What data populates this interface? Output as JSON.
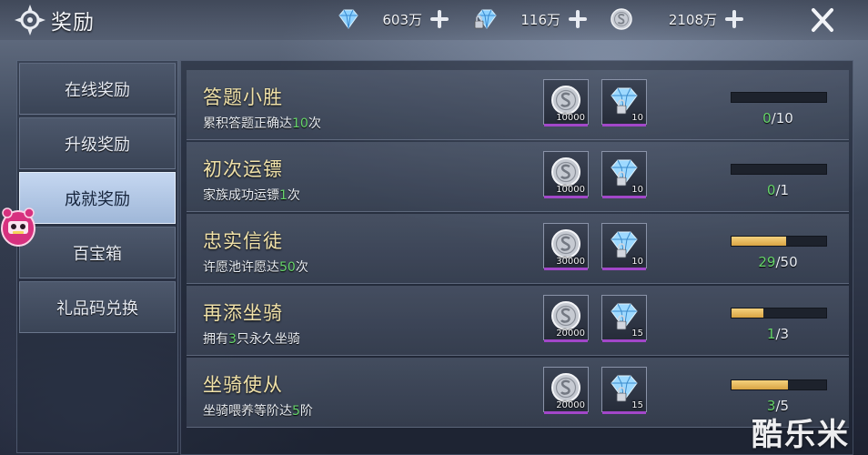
{
  "header": {
    "title": "奖励",
    "currencies": [
      {
        "icon": "diamond-icon",
        "value": "603万"
      },
      {
        "icon": "bound-diamond-icon",
        "value": "116万"
      },
      {
        "icon": "silver-coin-icon",
        "value": "2108万"
      }
    ]
  },
  "sidebar": {
    "items": [
      {
        "label": "在线奖励",
        "active": false
      },
      {
        "label": "升级奖励",
        "active": false
      },
      {
        "label": "成就奖励",
        "active": true
      },
      {
        "label": "百宝箱",
        "active": false
      },
      {
        "label": "礼品码兑换",
        "active": false
      }
    ]
  },
  "achievements": [
    {
      "title": "答题小胜",
      "desc_pre": "累积答题正确达",
      "desc_num": "10",
      "desc_post": "次",
      "rewards": [
        {
          "icon": "silver-coin-icon",
          "count": "10000"
        },
        {
          "icon": "locked-diamond-icon",
          "count": "10"
        }
      ],
      "progress_current": "0",
      "progress_total": "/10",
      "progress_fraction": 0
    },
    {
      "title": "初次运镖",
      "desc_pre": "家族成功运镖",
      "desc_num": "1",
      "desc_post": "次",
      "rewards": [
        {
          "icon": "silver-coin-icon",
          "count": "10000"
        },
        {
          "icon": "locked-diamond-icon",
          "count": "10"
        }
      ],
      "progress_current": "0",
      "progress_total": "/1",
      "progress_fraction": 0
    },
    {
      "title": "忠实信徒",
      "desc_pre": "许愿池许愿达",
      "desc_num": "50",
      "desc_post": "次",
      "rewards": [
        {
          "icon": "silver-coin-icon",
          "count": "30000"
        },
        {
          "icon": "locked-diamond-icon",
          "count": "10"
        }
      ],
      "progress_current": "29",
      "progress_total": "/50",
      "progress_fraction": 0.58
    },
    {
      "title": "再添坐骑",
      "desc_pre": "拥有",
      "desc_num": "3",
      "desc_post": "只永久坐骑",
      "rewards": [
        {
          "icon": "silver-coin-icon",
          "count": "20000"
        },
        {
          "icon": "locked-diamond-icon",
          "count": "15"
        }
      ],
      "progress_current": "1",
      "progress_total": "/3",
      "progress_fraction": 0.333
    },
    {
      "title": "坐骑使从",
      "desc_pre": "坐骑喂养等阶达",
      "desc_num": "5",
      "desc_post": "阶",
      "rewards": [
        {
          "icon": "silver-coin-icon",
          "count": "20000"
        },
        {
          "icon": "locked-diamond-icon",
          "count": "15"
        }
      ],
      "progress_current": "3",
      "progress_total": "/5",
      "progress_fraction": 0.6
    }
  ],
  "watermark": "酷乐米",
  "colors": {
    "title_gold": "#f0e1a8",
    "highlight_green": "#66d46a",
    "progress_gold": "#e8b85a",
    "active_tab": "#b3c8e6",
    "reward_border_purple": "#a247c9"
  }
}
